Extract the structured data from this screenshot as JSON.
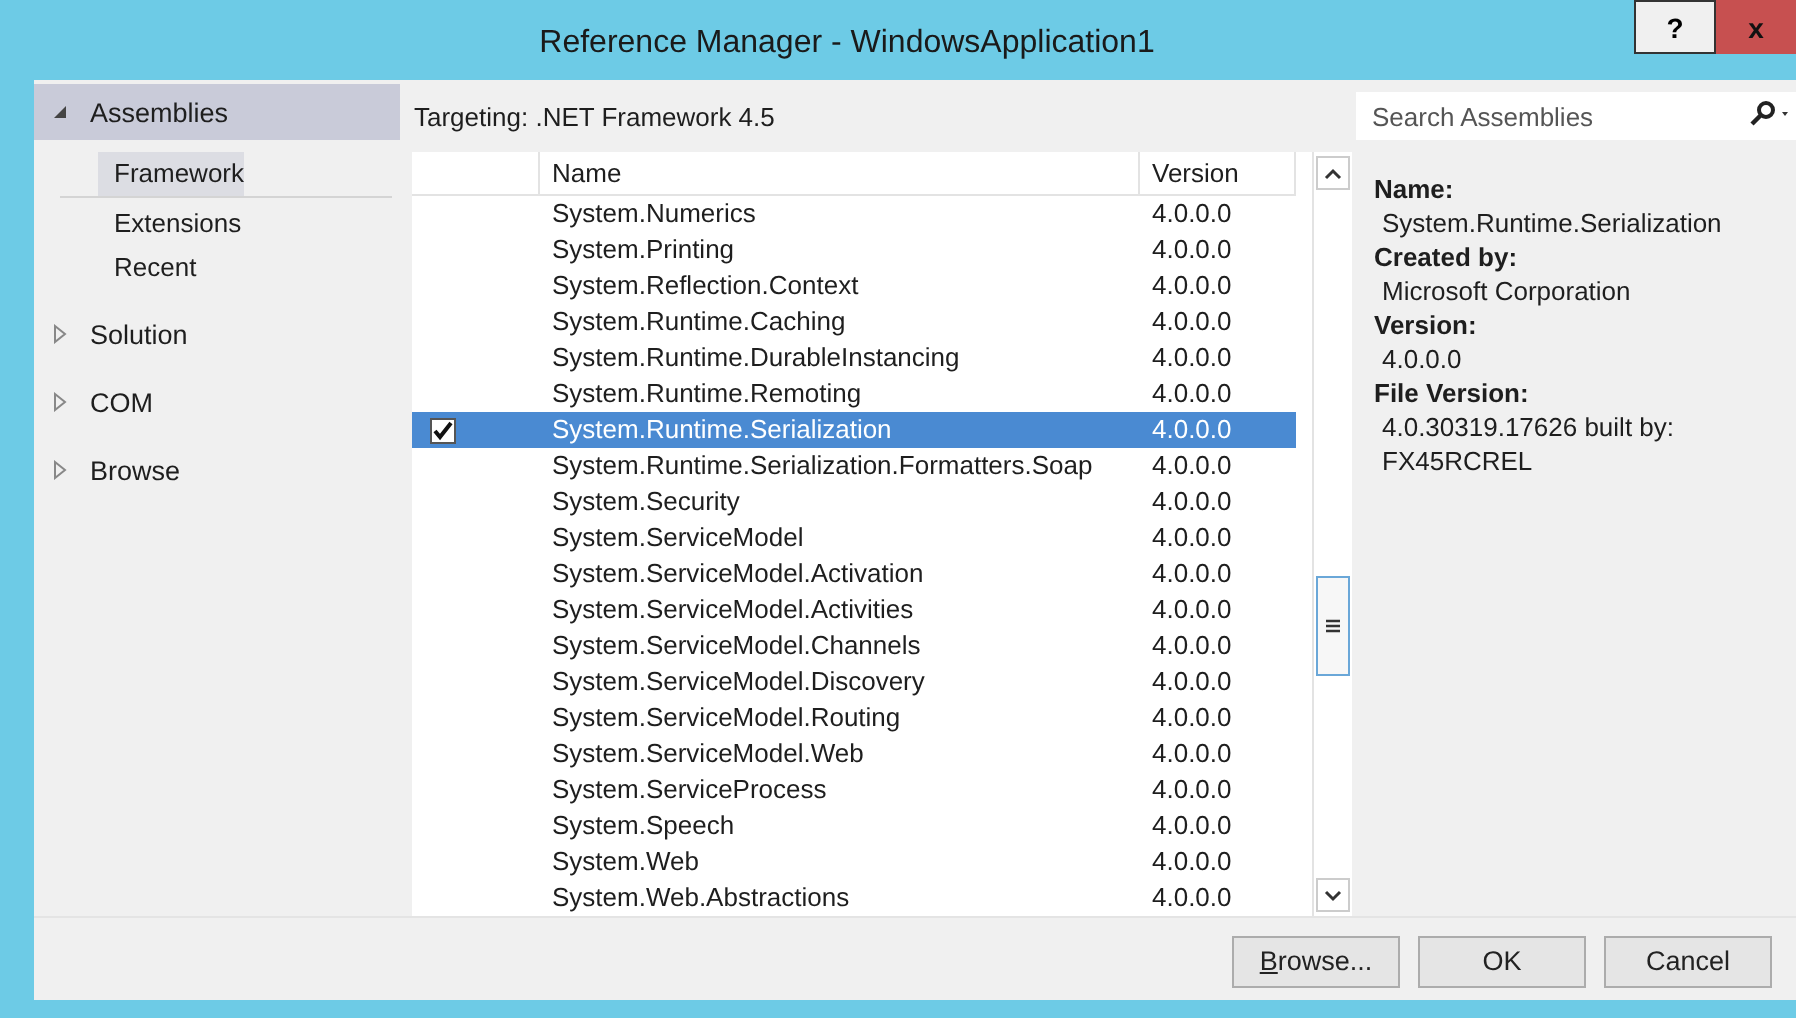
{
  "window": {
    "title": "Reference Manager - WindowsApplication1",
    "help_button": "?",
    "close_button": "x"
  },
  "sidebar": {
    "items": [
      {
        "label": "Assemblies",
        "expanded": true,
        "children": [
          {
            "label": "Framework",
            "selected": true
          },
          {
            "label": "Extensions",
            "selected": false
          },
          {
            "label": "Recent",
            "selected": false
          }
        ]
      },
      {
        "label": "Solution",
        "expanded": false
      },
      {
        "label": "COM",
        "expanded": false
      },
      {
        "label": "Browse",
        "expanded": false
      }
    ]
  },
  "targeting": "Targeting: .NET Framework 4.5",
  "search": {
    "placeholder": "Search Assemblies"
  },
  "table": {
    "columns": [
      "Name",
      "Version"
    ],
    "rows": [
      {
        "name": "System.Numerics",
        "version": "4.0.0.0",
        "checked": false,
        "selected": false
      },
      {
        "name": "System.Printing",
        "version": "4.0.0.0",
        "checked": false,
        "selected": false
      },
      {
        "name": "System.Reflection.Context",
        "version": "4.0.0.0",
        "checked": false,
        "selected": false
      },
      {
        "name": "System.Runtime.Caching",
        "version": "4.0.0.0",
        "checked": false,
        "selected": false
      },
      {
        "name": "System.Runtime.DurableInstancing",
        "version": "4.0.0.0",
        "checked": false,
        "selected": false
      },
      {
        "name": "System.Runtime.Remoting",
        "version": "4.0.0.0",
        "checked": false,
        "selected": false
      },
      {
        "name": "System.Runtime.Serialization",
        "version": "4.0.0.0",
        "checked": true,
        "selected": true
      },
      {
        "name": "System.Runtime.Serialization.Formatters.Soap",
        "version": "4.0.0.0",
        "checked": false,
        "selected": false
      },
      {
        "name": "System.Security",
        "version": "4.0.0.0",
        "checked": false,
        "selected": false
      },
      {
        "name": "System.ServiceModel",
        "version": "4.0.0.0",
        "checked": false,
        "selected": false
      },
      {
        "name": "System.ServiceModel.Activation",
        "version": "4.0.0.0",
        "checked": false,
        "selected": false
      },
      {
        "name": "System.ServiceModel.Activities",
        "version": "4.0.0.0",
        "checked": false,
        "selected": false
      },
      {
        "name": "System.ServiceModel.Channels",
        "version": "4.0.0.0",
        "checked": false,
        "selected": false
      },
      {
        "name": "System.ServiceModel.Discovery",
        "version": "4.0.0.0",
        "checked": false,
        "selected": false
      },
      {
        "name": "System.ServiceModel.Routing",
        "version": "4.0.0.0",
        "checked": false,
        "selected": false
      },
      {
        "name": "System.ServiceModel.Web",
        "version": "4.0.0.0",
        "checked": false,
        "selected": false
      },
      {
        "name": "System.ServiceProcess",
        "version": "4.0.0.0",
        "checked": false,
        "selected": false
      },
      {
        "name": "System.Speech",
        "version": "4.0.0.0",
        "checked": false,
        "selected": false
      },
      {
        "name": "System.Web",
        "version": "4.0.0.0",
        "checked": false,
        "selected": false
      },
      {
        "name": "System.Web.Abstractions",
        "version": "4.0.0.0",
        "checked": false,
        "selected": false
      }
    ]
  },
  "details": [
    {
      "label": "Name:",
      "value": "System.Runtime.Serialization"
    },
    {
      "label": "Created by:",
      "value": "Microsoft Corporation"
    },
    {
      "label": "Version:",
      "value": "4.0.0.0"
    },
    {
      "label": "File Version:",
      "value": "4.0.30319.17626 built by: FX45RCREL"
    }
  ],
  "buttons": [
    {
      "label": "Browse...",
      "underline_first": true
    },
    {
      "label": "OK",
      "underline_first": false
    },
    {
      "label": "Cancel",
      "underline_first": false
    }
  ]
}
